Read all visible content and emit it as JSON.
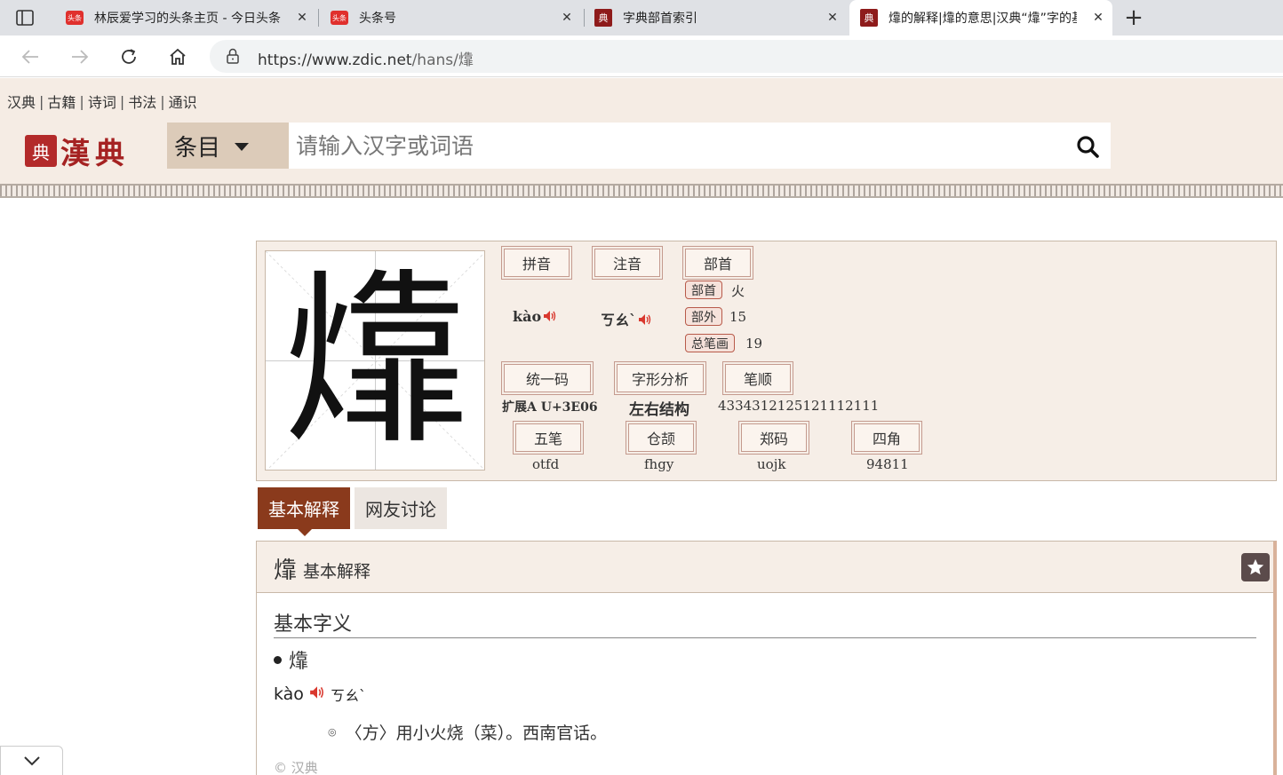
{
  "browser": {
    "tabs": [
      {
        "title": "林辰爱学习的头条主页 - 今日头条",
        "favicon": "toutiao"
      },
      {
        "title": "头条号",
        "favicon": "toutiao"
      },
      {
        "title": "字典部首索引",
        "favicon": "zdic"
      },
      {
        "title": "㸆的解释|㸆的意思|汉典“㸆”字的基本解释",
        "favicon": "zdic",
        "active": true
      }
    ],
    "favicon_toutiao_label": "头条",
    "url_host": "https://www.zdic.net",
    "url_path": "/hans/㸆"
  },
  "site": {
    "top_links": [
      "汉典",
      "古籍",
      "诗词",
      "书法",
      "通识"
    ],
    "logo_seal": "典",
    "logo_text": "漢典",
    "search_type": "条目",
    "search_placeholder": "请输入汉字或词语"
  },
  "character": {
    "glyph": "㸆",
    "labels": {
      "pinyin": "拼音",
      "zhuyin": "注音",
      "radical_header": "部首",
      "unicode": "统一码",
      "structure": "字形分析",
      "stroke_order": "笔顺",
      "wubi": "五笔",
      "cangjie": "仓颉",
      "zhengma": "郑码",
      "sijiao": "四角"
    },
    "pinyin": "kào",
    "zhuyin": "ㄎㄠˋ",
    "radical": {
      "label": "部首",
      "value": "火"
    },
    "strokes_outside": {
      "label": "部外",
      "value": "15"
    },
    "strokes_total": {
      "label": "总笔画",
      "value": "19"
    },
    "unicode": "扩展A U+3E06",
    "structure": "左右结构",
    "stroke_order": "4334312125121112111",
    "wubi": "otfd",
    "cangjie": "fhgy",
    "zhengma": "uojk",
    "sijiao": "94811"
  },
  "tabs": {
    "basic": "基本解释",
    "discussion": "网友讨论"
  },
  "definition": {
    "header_char": "㸆",
    "header_title": "基本解释",
    "section_title": "基本字义",
    "entry_char": "㸆",
    "pinyin": "kào",
    "zhuyin": "ㄎㄠˋ",
    "meaning": "〈方〉用小火烧（菜）。西南官话。",
    "meaning_marker": "◎",
    "copyright": "© 汉典"
  },
  "colors": {
    "accent": "#8a3a1c",
    "header_bg": "#f5ece4",
    "card_bg": "#f6eee7"
  }
}
